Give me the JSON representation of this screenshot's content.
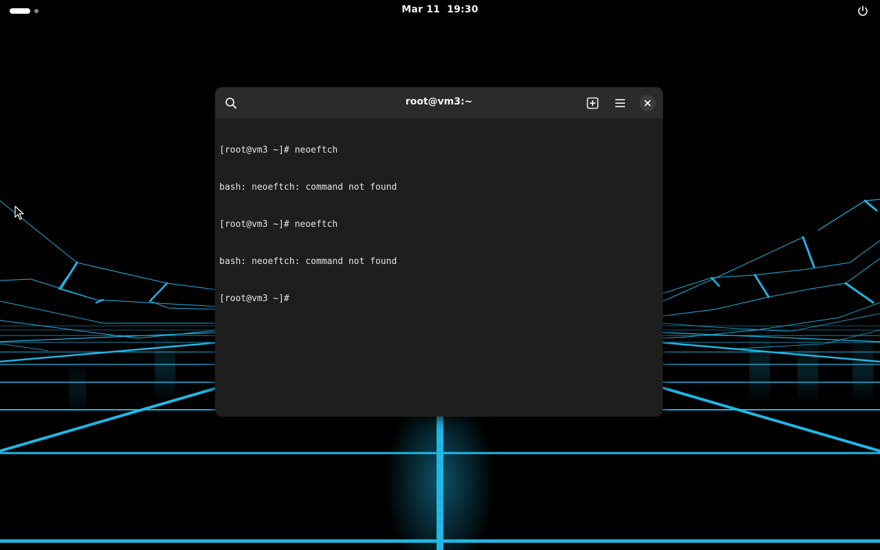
{
  "topbar": {
    "date": "Mar 11",
    "time": "19:30"
  },
  "terminal": {
    "title": "root@vm3:~",
    "lines": [
      "[root@vm3 ~]# neoeftch",
      "bash: neoeftch: command not found",
      "[root@vm3 ~]# neoeftch",
      "bash: neoeftch: command not found",
      "[root@vm3 ~]# "
    ]
  },
  "icons": {
    "activities": "activities-indicator",
    "power": "power-icon",
    "search": "search-icon",
    "new_tab": "new-tab-icon",
    "menu": "hamburger-menu-icon",
    "close": "close-icon",
    "pointer": "mouse-pointer-icon"
  },
  "colors": {
    "wallpaper_accent": "#1fb8e6",
    "terminal_bg": "#1e1e1e",
    "titlebar_bg": "#2b2b2b",
    "text": "#e6e6e6"
  }
}
